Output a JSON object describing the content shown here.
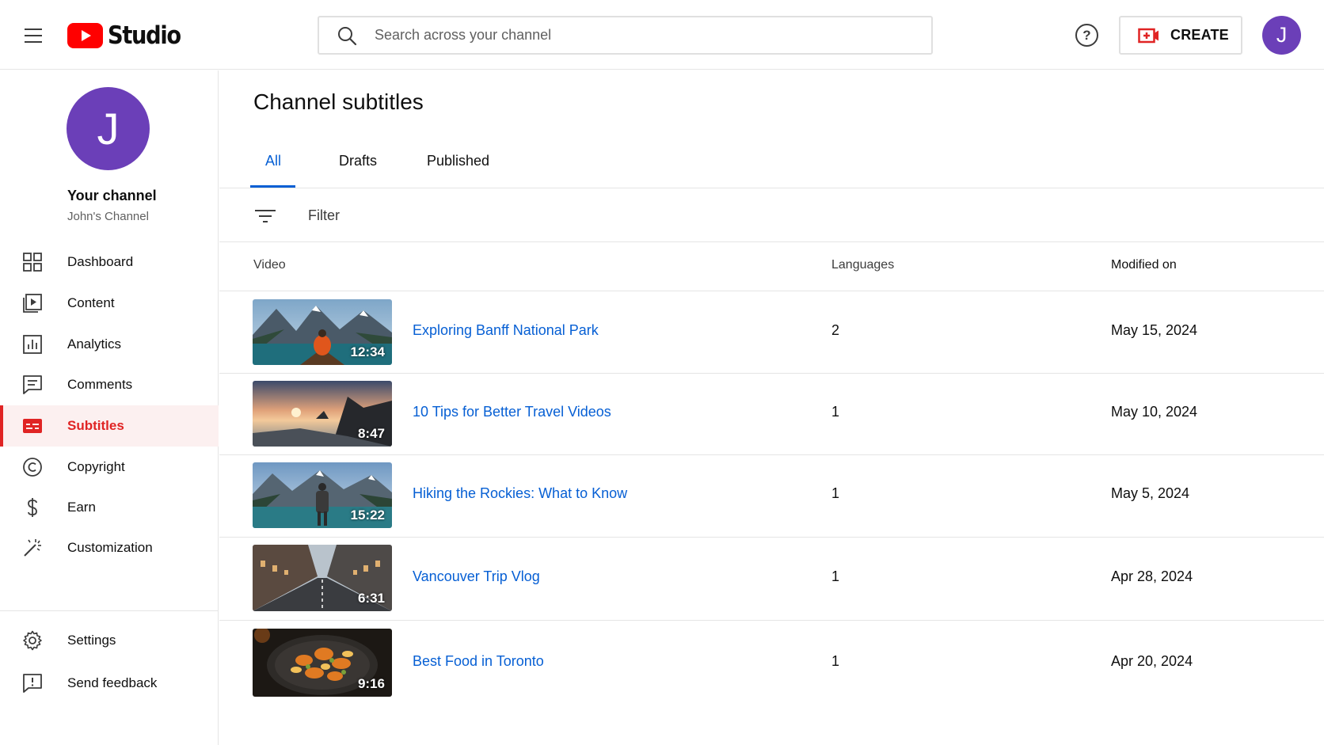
{
  "header": {
    "logo_text": "Studio",
    "search_placeholder": "Search across your channel",
    "help_label": "?",
    "create_label": "CREATE",
    "avatar_letter": "J",
    "colors": {
      "brand_red": "#ff0000",
      "avatar": "#6b3fb8",
      "link": "#065fd4"
    }
  },
  "sidebar": {
    "avatar_letter": "J",
    "channel_title": "Your channel",
    "channel_name": "John's Channel",
    "items": [
      {
        "label": "Dashboard",
        "icon": "dashboard-icon"
      },
      {
        "label": "Content",
        "icon": "content-icon"
      },
      {
        "label": "Analytics",
        "icon": "analytics-icon"
      },
      {
        "label": "Comments",
        "icon": "comments-icon"
      },
      {
        "label": "Subtitles",
        "icon": "subtitles-icon",
        "active": true
      },
      {
        "label": "Copyright",
        "icon": "copyright-icon"
      },
      {
        "label": "Earn",
        "icon": "dollar-icon"
      },
      {
        "label": "Customization",
        "icon": "magic-wand-icon"
      }
    ],
    "bottom_items": [
      {
        "label": "Settings",
        "icon": "gear-icon"
      },
      {
        "label": "Send feedback",
        "icon": "feedback-icon"
      }
    ]
  },
  "main": {
    "title": "Channel subtitles",
    "tabs": [
      {
        "label": "All",
        "active": true
      },
      {
        "label": "Drafts"
      },
      {
        "label": "Published"
      }
    ],
    "filter_label": "Filter",
    "columns": {
      "video": "Video",
      "languages": "Languages",
      "modified": "Modified on"
    },
    "videos": [
      {
        "title": "Exploring Banff National Park",
        "duration": "12:34",
        "languages": "2",
        "modified": "May 15, 2024",
        "thumb": "mountain-lake-canoe"
      },
      {
        "title": "10 Tips for Better Travel Videos",
        "duration": "8:47",
        "languages": "1",
        "modified": "May 10, 2024",
        "thumb": "sunset-beach"
      },
      {
        "title": "Hiking the Rockies: What to Know",
        "duration": "15:22",
        "languages": "1",
        "modified": "May 5, 2024",
        "thumb": "hiker-mountains"
      },
      {
        "title": "Vancouver Trip Vlog",
        "duration": "6:31",
        "languages": "1",
        "modified": "Apr 28, 2024",
        "thumb": "city-street"
      },
      {
        "title": "Best Food in Toronto",
        "duration": "9:16",
        "languages": "1",
        "modified": "Apr 20, 2024",
        "thumb": "food-plate"
      }
    ]
  }
}
